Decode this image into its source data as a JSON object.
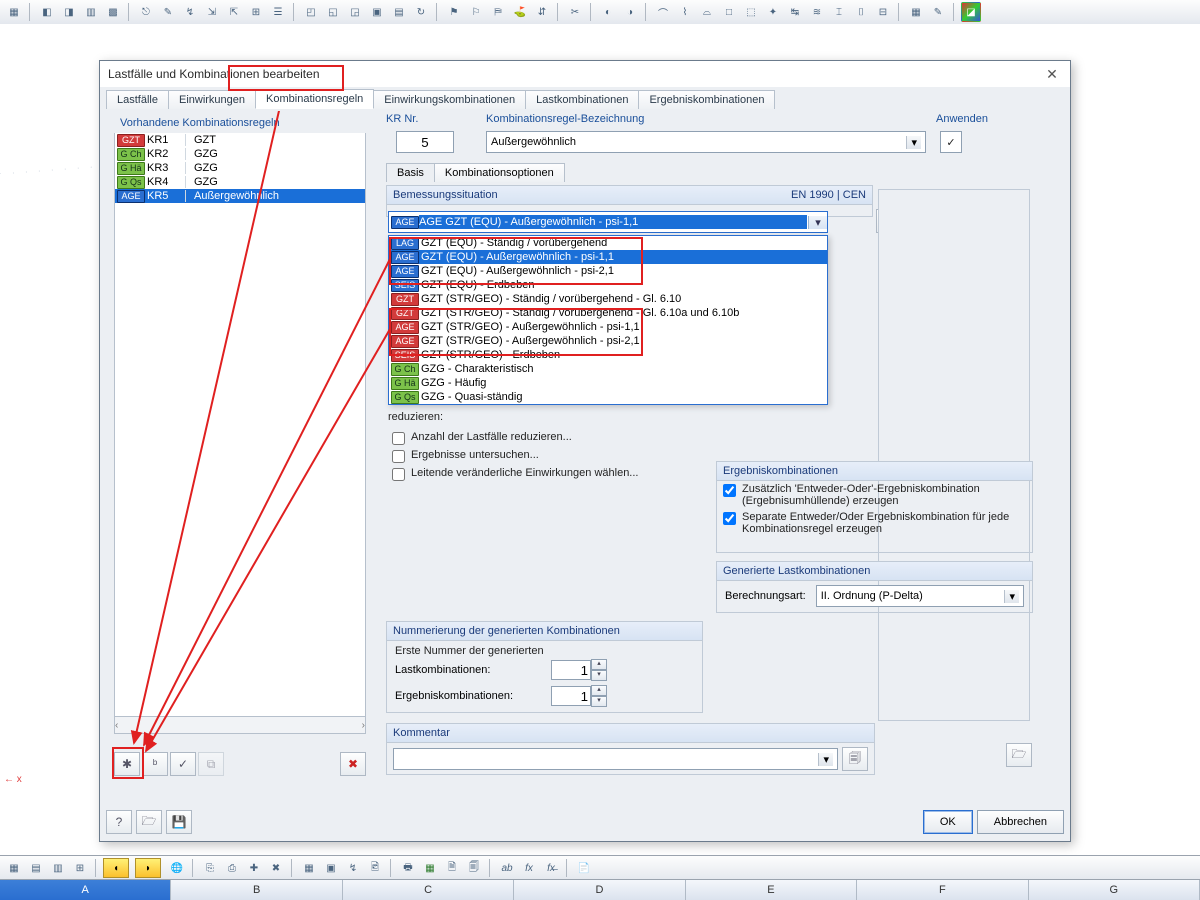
{
  "dialog": {
    "title": "Lastfälle und Kombinationen bearbeiten",
    "tabs": [
      "Lastfälle",
      "Einwirkungen",
      "Kombinationsregeln",
      "Einwirkungskombinationen",
      "Lastkombinationen",
      "Ergebniskombinationen"
    ],
    "active_tab": 2,
    "left": {
      "header": "Vorhandene Kombinationsregeln",
      "rows": [
        {
          "tag": "GZT",
          "tag_cls": "tag-red",
          "id": "KR1",
          "name": "GZT"
        },
        {
          "tag": "G Ch",
          "tag_cls": "tag-green",
          "id": "KR2",
          "name": "GZG"
        },
        {
          "tag": "G Hä",
          "tag_cls": "tag-green",
          "id": "KR3",
          "name": "GZG"
        },
        {
          "tag": "G Qs",
          "tag_cls": "tag-green",
          "id": "KR4",
          "name": "GZG"
        },
        {
          "tag": "AGE",
          "tag_cls": "tag-blue",
          "id": "KR5",
          "name": "Außergewöhnlich",
          "sel": true
        }
      ]
    },
    "kr": {
      "label": "KR Nr.",
      "value": "5"
    },
    "name": {
      "label": "Kombinationsregel-Bezeichnung",
      "value": "Außergewöhnlich"
    },
    "apply": {
      "label": "Anwenden",
      "checked": true
    },
    "subtabs": [
      "Basis",
      "Kombinationsoptionen"
    ],
    "bem": {
      "label": "Bemessungssituation",
      "norm": "EN 1990 | CEN",
      "selected": "AGE GZT (EQU) - Außergewöhnlich - psi-1,1"
    },
    "dropdown": [
      {
        "tag": "LAG",
        "tag_cls": "tag-blue",
        "text": "GZT (EQU) - Ständig / vorübergehend"
      },
      {
        "tag": "AGE",
        "tag_cls": "tag-blue",
        "text": "GZT (EQU) - Außergewöhnlich - psi-1,1",
        "hl": true,
        "box": 1
      },
      {
        "tag": "AGE",
        "tag_cls": "tag-blue",
        "text": "GZT (EQU) - Außergewöhnlich - psi-2,1",
        "box": 1
      },
      {
        "tag": "SEIS",
        "tag_cls": "tag-blue",
        "text": "GZT (EQU) - Erdbeben",
        "box": 1
      },
      {
        "tag": "GZT",
        "tag_cls": "tag-red",
        "text": "GZT (STR/GEO) - Ständig / vorübergehend - Gl. 6.10"
      },
      {
        "tag": "GZT",
        "tag_cls": "tag-red",
        "text": "GZT (STR/GEO) - Ständig / vorübergehend - Gl. 6.10a und 6.10b"
      },
      {
        "tag": "AGE",
        "tag_cls": "tag-red",
        "text": "GZT (STR/GEO) - Außergewöhnlich - psi-1,1",
        "box": 2
      },
      {
        "tag": "AGE",
        "tag_cls": "tag-red",
        "text": "GZT (STR/GEO) - Außergewöhnlich - psi-2,1",
        "box": 2
      },
      {
        "tag": "SEIS",
        "tag_cls": "tag-red",
        "text": "GZT (STR/GEO) - Erdbeben",
        "box": 2
      },
      {
        "tag": "G Ch",
        "tag_cls": "tag-green",
        "text": "GZG - Charakteristisch"
      },
      {
        "tag": "G Hä",
        "tag_cls": "tag-green",
        "text": "GZG - Häufig"
      },
      {
        "tag": "G Qs",
        "tag_cls": "tag-green",
        "text": "GZG - Quasi-ständig"
      }
    ],
    "reduce": {
      "tail": "reduzieren:",
      "c1": "Anzahl der Lastfälle reduzieren...",
      "c2": "Ergebnisse untersuchen...",
      "c3": "Leitende veränderliche Einwirkungen wählen..."
    },
    "ek": {
      "title": "Ergebniskombinationen",
      "c1": "Zusätzlich 'Entweder-Oder'-Ergebniskombination (Ergebnisumhüllende) erzeugen",
      "c2": "Separate Entweder/Oder Ergebniskombination für jede Kombinationsregel erzeugen"
    },
    "gl": {
      "title": "Generierte Lastkombinationen",
      "label": "Berechnungsart:",
      "value": "II. Ordnung (P-Delta)"
    },
    "num": {
      "title": "Nummerierung der generierten Kombinationen",
      "sub": "Erste Nummer der generierten",
      "r1": "Lastkombinationen:",
      "v1": "1",
      "r2": "Ergebniskombinationen:",
      "v2": "1"
    },
    "kom": {
      "title": "Kommentar",
      "value": ""
    },
    "buttons": {
      "ok": "OK",
      "cancel": "Abbrechen"
    }
  },
  "col_headers": [
    "A",
    "B",
    "C",
    "D",
    "E",
    "F",
    "G"
  ]
}
